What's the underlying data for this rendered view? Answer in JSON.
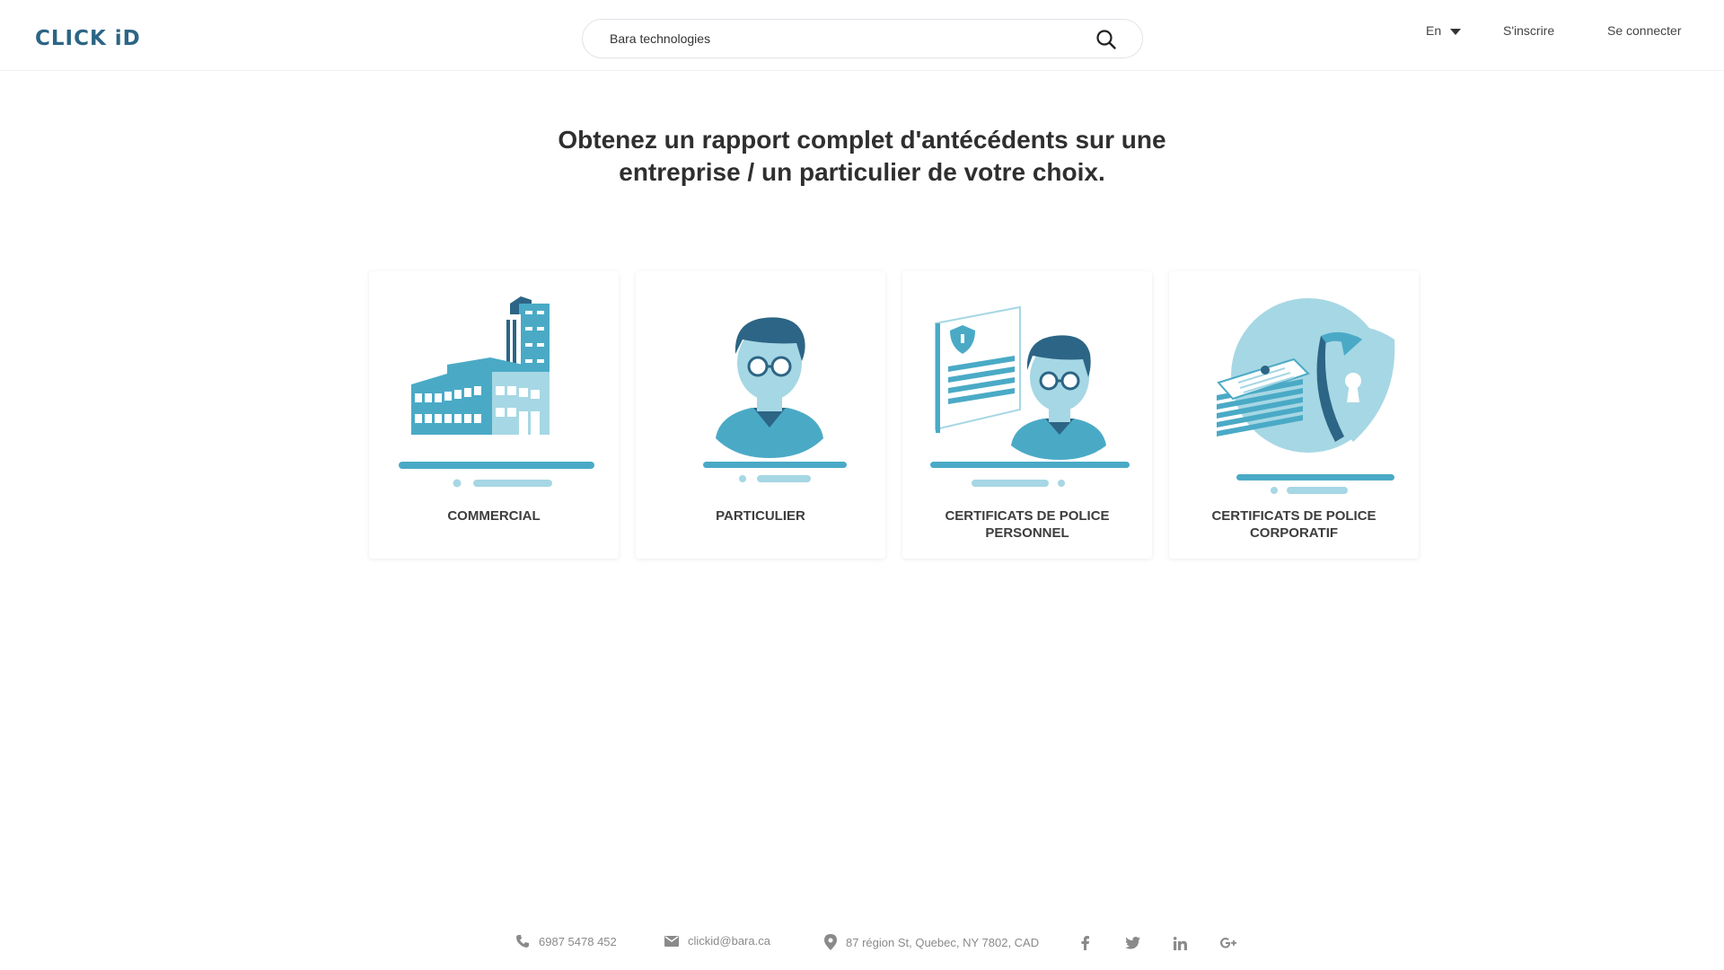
{
  "header": {
    "logo": "CLICK iD",
    "search": {
      "value": "Bara technologies"
    },
    "language": "En",
    "signup": "S'inscrire",
    "login": "Se connecter"
  },
  "main": {
    "title": "Obtenez un rapport complet d'antécédents sur une entreprise / un particulier de votre choix.",
    "cards": [
      {
        "label": "COMMERCIAL",
        "icon": "building-icon"
      },
      {
        "label": "PARTICULIER",
        "icon": "person-icon"
      },
      {
        "label": "CERTIFICATS DE POLICE PERSONNEL",
        "icon": "person-certificate-icon"
      },
      {
        "label": "CERTIFICATS DE POLICE CORPORATIF",
        "icon": "documents-shield-icon"
      }
    ]
  },
  "footer": {
    "phone": "6987 5478 452",
    "email": "clickid@bara.ca",
    "address": "87 région St, Quebec, NY 7802, CAD",
    "social": [
      "facebook",
      "twitter",
      "linkedin",
      "google-plus"
    ]
  },
  "colors": {
    "brand": "#2c6585",
    "accent": "#4aaac6",
    "light": "#a6d7e4"
  }
}
